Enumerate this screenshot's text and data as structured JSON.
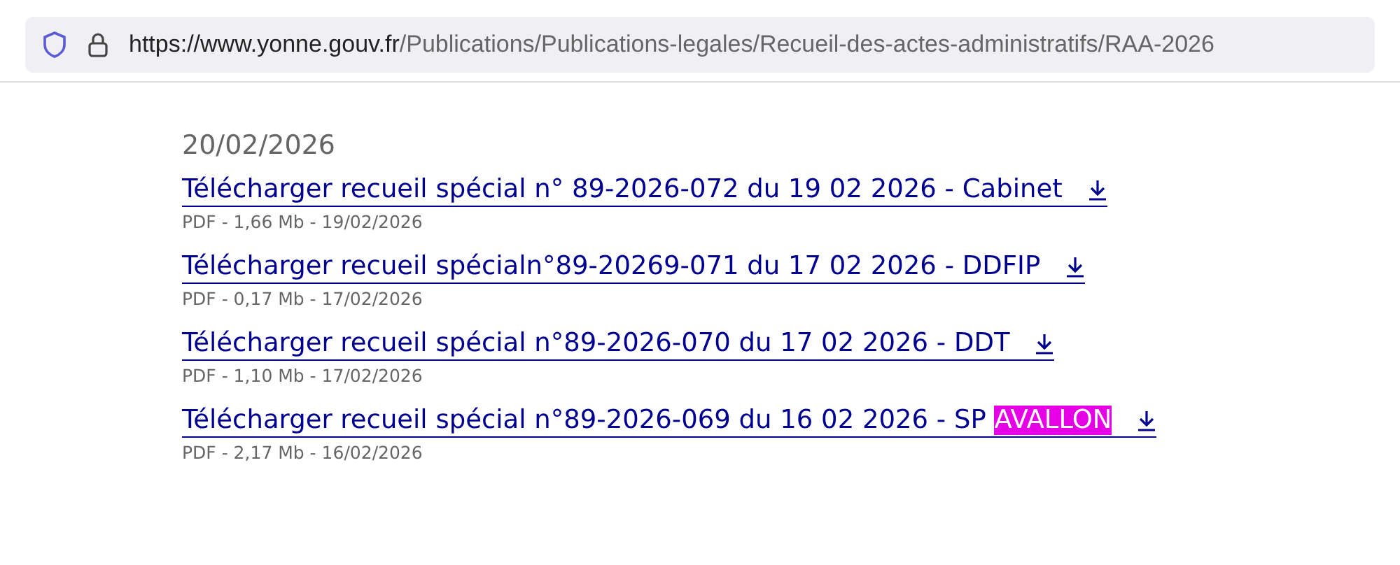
{
  "address_bar": {
    "host": "https://www.yonne.gouv.fr",
    "path": "/Publications/Publications-legales/Recueil-des-actes-administratifs/RAA-2026"
  },
  "date_heading": "20/02/2026",
  "documents": [
    {
      "title": "Télécharger recueil spécial n° 89-2026-072 du 19 02 2026 - Cabinet",
      "meta": "PDF - 1,66 Mb - 19/02/2026"
    },
    {
      "title": "Télécharger recueil spécialn°89-20269-071 du 17 02 2026 - DDFIP",
      "meta": "PDF - 0,17 Mb - 17/02/2026"
    },
    {
      "title": "Télécharger recueil spécial n°89-2026-070 du 17 02 2026 - DDT",
      "meta": "PDF - 1,10 Mb - 17/02/2026"
    },
    {
      "title": "Télécharger recueil spécial n°89-2026-069 du 16 02 2026 - SP ",
      "highlight": "AVALLON",
      "meta": "PDF - 2,17 Mb - 16/02/2026"
    }
  ]
}
